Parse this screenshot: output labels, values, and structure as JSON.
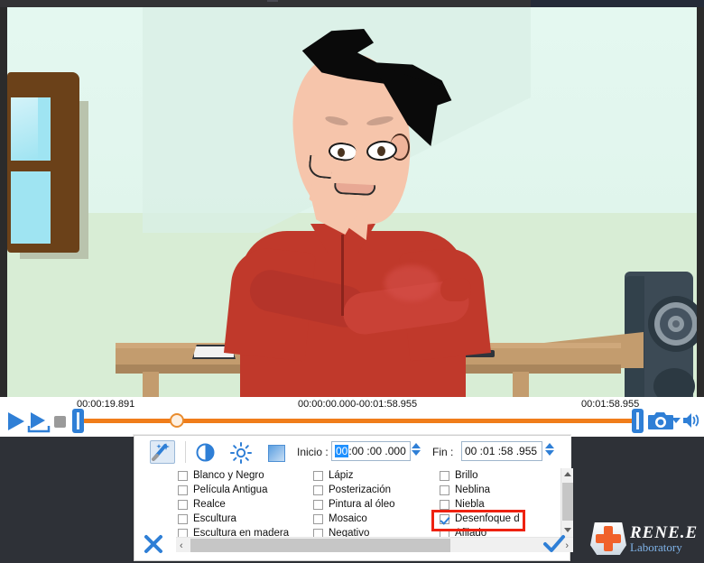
{
  "video": {
    "scene_description": "cartoon man with pompadour hair, arms crossed, red shirt, at a table with laptop and speaker"
  },
  "transport": {
    "play_label": "play-icon",
    "play_selection_label": "play-selection-icon",
    "stop_label": "stop-icon",
    "snapshot_label": "camera-icon",
    "snapshot_dropdown_label": "chevron-down-icon",
    "volume_label": "volume-icon",
    "current_time": "00:00:19.891",
    "range_text": "00:00:00.000-00:01:58.955",
    "total_time": "00:01:58.955"
  },
  "dialog": {
    "toolbar": {
      "magic_wand": "magic-wand-icon",
      "contrast": "contrast-icon",
      "brightness": "brightness-icon",
      "gradient": "gradient-icon"
    },
    "fields": {
      "inicio_label": "Inicio :",
      "inicio_selected_segment": "00",
      "inicio_rest": ":00 :00 .000",
      "fin_label": "Fin :",
      "fin_value": "00 :01 :58 .955"
    },
    "effects": {
      "column1": [
        {
          "label": "Blanco y Negro",
          "checked": false
        },
        {
          "label": "Película Antigua",
          "checked": false
        },
        {
          "label": "Realce",
          "checked": false
        },
        {
          "label": "Escultura",
          "checked": false
        },
        {
          "label": "Escultura en madera",
          "checked": false
        }
      ],
      "column2": [
        {
          "label": "Lápiz",
          "checked": false
        },
        {
          "label": "Posterización",
          "checked": false
        },
        {
          "label": "Pintura al óleo",
          "checked": false
        },
        {
          "label": "Mosaico",
          "checked": false
        },
        {
          "label": "Negativo",
          "checked": false
        }
      ],
      "column3": [
        {
          "label": "Brillo",
          "checked": false
        },
        {
          "label": "Neblina",
          "checked": false
        },
        {
          "label": "Niebla",
          "checked": false
        },
        {
          "label": "Desenfoque d",
          "checked": true
        },
        {
          "label": "Afilado",
          "checked": false
        }
      ]
    },
    "buttons": {
      "cancel": "close-x-icon",
      "confirm": "checkmark-icon"
    },
    "scroll": {
      "h_left": "‹",
      "h_right": "›"
    }
  },
  "logo": {
    "brand": "RENE.E",
    "sub": "Laboratory"
  },
  "colors": {
    "accent_blue": "#2f7fd6",
    "timeline_orange": "#f07d1a",
    "highlight_red": "#ee2211",
    "shirt_red": "#c0392b"
  }
}
